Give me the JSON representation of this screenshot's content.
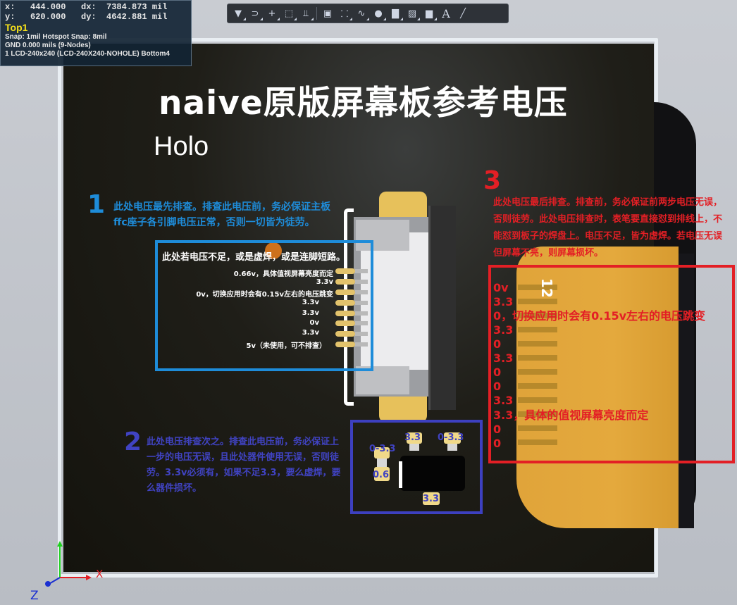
{
  "info_panel": {
    "line1": "x:   444.000   dx:  7384.873 mil",
    "line2": "y:   620.000   dy:  4642.881 mil",
    "layer": "Top1",
    "snap": "Snap: 1mil Hotspot Snap: 8mil",
    "net": "GND      0.000 mils  (9-Nodes)",
    "component": "1  LCD-240x240  (LCD-240X240-NOHOLE)  Bottom4"
  },
  "toolbar": {
    "icons": [
      "filter-icon",
      "magnet-icon",
      "crosshair-icon",
      "select-rect-icon",
      "align-bottom-icon",
      "chip-icon",
      "route-icon",
      "wave-icon",
      "pin-icon",
      "layer-stack-icon",
      "graph-icon",
      "bar-chart-icon",
      "text-icon",
      "line-icon"
    ],
    "text_tool": "A"
  },
  "board": {
    "title": "naive原版屏幕板参考电压",
    "subtitle": "Holo"
  },
  "annotation1": {
    "number": "1",
    "text": "此处电压最先排查。排查此电压前，务必保证主板ffc座子各引脚电压正常，否则一切皆为徒劳。",
    "box_heading": "此处若电压不足，或是虚焊，或是连脚短路。",
    "pin_labels": [
      "0.66v，具体值视屏幕亮度而定",
      "3.3v",
      "0v，切换应用时会有0.15v左右的电压跳变",
      "3.3v",
      "3.3v",
      "0v",
      "3.3v",
      "5v（未使用，可不排查）"
    ]
  },
  "annotation2": {
    "number": "2",
    "text": "此处电压排查次之。排查此电压前，务必保证上一步的电压无误，且此处器件使用无误，否则徒劳。3.3v必须有，如果不足3.3，要么虚焊，要么器件损坏。",
    "comp_labels": [
      "0-3.3",
      "3.3",
      "0-3.3",
      "0.6",
      "3.3"
    ]
  },
  "annotation3": {
    "number": "3",
    "text": "此处电压最后排查。排查前，务必保证前两步电压无误，否则徒劳。此处电压排查时，表笔要直接怼到排线上，不能怼到板子的焊盘上。电压不足，皆为虚焊。若电压无误但屏幕不亮，则屏幕损坏。",
    "pin_number": "12",
    "pin_labels": [
      "0v",
      "3.3",
      "0，切换应用时会有0.15v左右的电压跳变",
      "3.3",
      "0",
      "3.3",
      "0",
      "0",
      "3.3",
      "3.3，具体的值视屏幕亮度而定",
      "0",
      "0"
    ]
  },
  "axis": {
    "z_label": "Z",
    "x_label": "X"
  },
  "colors": {
    "blue": "#1e8cd9",
    "indigo": "#4043c2",
    "red": "#e31f25",
    "gold": "#e4a93d"
  }
}
